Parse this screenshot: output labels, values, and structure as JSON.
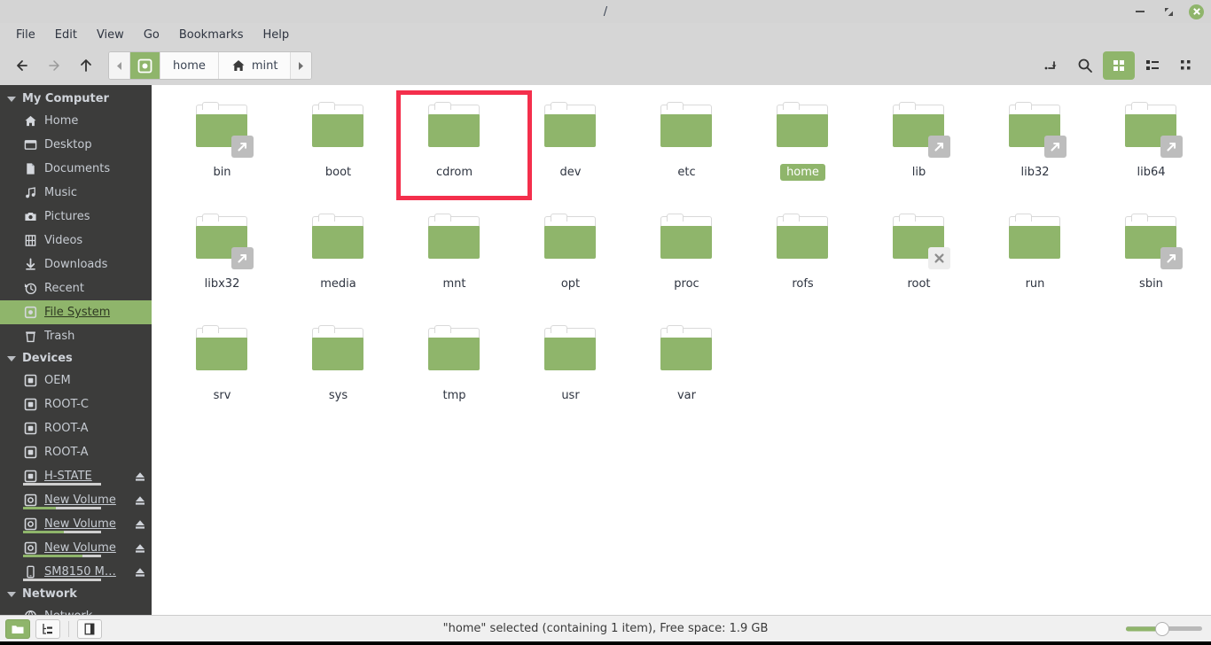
{
  "window": {
    "title": "/",
    "buttons": {
      "minimize": "minimize",
      "maximize": "maximize",
      "close": "close"
    }
  },
  "menubar": {
    "items": [
      "File",
      "Edit",
      "View",
      "Go",
      "Bookmarks",
      "Help"
    ]
  },
  "toolbar": {
    "back": "back-icon",
    "forward": "forward-icon",
    "up": "up-icon",
    "breadcrumb": {
      "scroll_left": "chevron-left-icon",
      "scroll_right": "chevron-right-icon",
      "items": [
        {
          "label": "",
          "icon": "file-system-icon",
          "active": true
        },
        {
          "label": "home",
          "icon": "",
          "active": false
        },
        {
          "label": "mint",
          "icon": "home-icon",
          "active": false
        }
      ]
    },
    "right_buttons": [
      {
        "name": "toggle-location-entry-button",
        "icon": "path-entry-icon",
        "active": false
      },
      {
        "name": "search-button",
        "icon": "search-icon",
        "active": false
      },
      {
        "name": "icon-view-button",
        "icon": "grid-view-icon",
        "active": true
      },
      {
        "name": "list-view-button",
        "icon": "list-view-icon",
        "active": false
      },
      {
        "name": "compact-view-button",
        "icon": "compact-view-icon",
        "active": false
      }
    ]
  },
  "sidebar": {
    "sections": [
      {
        "title": "My Computer",
        "items": [
          {
            "label": "Home",
            "icon": "home-icon",
            "selected": false
          },
          {
            "label": "Desktop",
            "icon": "desktop-icon",
            "selected": false
          },
          {
            "label": "Documents",
            "icon": "document-icon",
            "selected": false
          },
          {
            "label": "Music",
            "icon": "music-icon",
            "selected": false
          },
          {
            "label": "Pictures",
            "icon": "camera-icon",
            "selected": false
          },
          {
            "label": "Videos",
            "icon": "film-icon",
            "selected": false
          },
          {
            "label": "Downloads",
            "icon": "download-icon",
            "selected": false
          },
          {
            "label": "Recent",
            "icon": "clock-icon",
            "selected": false
          },
          {
            "label": "File System",
            "icon": "file-system-icon",
            "selected": true
          },
          {
            "label": "Trash",
            "icon": "trash-icon",
            "selected": false
          }
        ]
      },
      {
        "title": "Devices",
        "items": [
          {
            "label": "OEM",
            "icon": "drive-icon",
            "selected": false,
            "eject": false,
            "link": false,
            "usage": null
          },
          {
            "label": "ROOT-C",
            "icon": "drive-icon",
            "selected": false,
            "eject": false,
            "link": false,
            "usage": null
          },
          {
            "label": "ROOT-A",
            "icon": "drive-icon",
            "selected": false,
            "eject": false,
            "link": false,
            "usage": null
          },
          {
            "label": "ROOT-A",
            "icon": "drive-icon",
            "selected": false,
            "eject": false,
            "link": false,
            "usage": null
          },
          {
            "label": "H-STATE",
            "icon": "drive-icon",
            "selected": false,
            "eject": true,
            "link": true,
            "usage": 0
          },
          {
            "label": "New Volume",
            "icon": "disk-icon",
            "selected": false,
            "eject": true,
            "link": true,
            "usage": 42
          },
          {
            "label": "New Volume",
            "icon": "disk-icon",
            "selected": false,
            "eject": true,
            "link": true,
            "usage": 52
          },
          {
            "label": "New Volume",
            "icon": "disk-icon",
            "selected": false,
            "eject": true,
            "link": true,
            "usage": 76
          },
          {
            "label": "SM8150 M…",
            "icon": "phone-icon",
            "selected": false,
            "eject": true,
            "link": true,
            "usage": 0
          }
        ]
      },
      {
        "title": "Network",
        "items": [
          {
            "label": "Network",
            "icon": "network-icon",
            "selected": false
          }
        ]
      }
    ]
  },
  "files": {
    "items": [
      {
        "name": "bin",
        "badge": "symlink",
        "selected": false,
        "highlighted": false
      },
      {
        "name": "boot",
        "badge": "",
        "selected": false,
        "highlighted": false
      },
      {
        "name": "cdrom",
        "badge": "",
        "selected": false,
        "highlighted": true
      },
      {
        "name": "dev",
        "badge": "",
        "selected": false,
        "highlighted": false
      },
      {
        "name": "etc",
        "badge": "",
        "selected": false,
        "highlighted": false
      },
      {
        "name": "home",
        "badge": "",
        "selected": true,
        "highlighted": false
      },
      {
        "name": "lib",
        "badge": "symlink",
        "selected": false,
        "highlighted": false
      },
      {
        "name": "lib32",
        "badge": "symlink",
        "selected": false,
        "highlighted": false
      },
      {
        "name": "lib64",
        "badge": "symlink",
        "selected": false,
        "highlighted": false
      },
      {
        "name": "libx32",
        "badge": "symlink",
        "selected": false,
        "highlighted": false
      },
      {
        "name": "media",
        "badge": "",
        "selected": false,
        "highlighted": false
      },
      {
        "name": "mnt",
        "badge": "",
        "selected": false,
        "highlighted": false
      },
      {
        "name": "opt",
        "badge": "",
        "selected": false,
        "highlighted": false
      },
      {
        "name": "proc",
        "badge": "",
        "selected": false,
        "highlighted": false
      },
      {
        "name": "rofs",
        "badge": "",
        "selected": false,
        "highlighted": false
      },
      {
        "name": "root",
        "badge": "noaccess",
        "selected": false,
        "highlighted": false
      },
      {
        "name": "run",
        "badge": "",
        "selected": false,
        "highlighted": false
      },
      {
        "name": "sbin",
        "badge": "symlink",
        "selected": false,
        "highlighted": false
      },
      {
        "name": "srv",
        "badge": "",
        "selected": false,
        "highlighted": false
      },
      {
        "name": "sys",
        "badge": "",
        "selected": false,
        "highlighted": false
      },
      {
        "name": "tmp",
        "badge": "",
        "selected": false,
        "highlighted": false
      },
      {
        "name": "usr",
        "badge": "",
        "selected": false,
        "highlighted": false
      },
      {
        "name": "var",
        "badge": "",
        "selected": false,
        "highlighted": false
      }
    ]
  },
  "statusbar": {
    "text": "\"home\" selected (containing 1 item), Free space: 1.9 GB",
    "buttons": [
      {
        "name": "icon-view-toggle",
        "icon": "folder-icon",
        "active": true
      },
      {
        "name": "tree-view-toggle",
        "icon": "tree-icon",
        "active": false
      },
      {
        "name": "sidebar-toggle",
        "icon": "sidebar-icon",
        "active": false
      }
    ],
    "zoom_percent": 48
  },
  "colors": {
    "accent": "#8fb56b",
    "sidebar_bg": "#3c3c3b",
    "chrome_bg": "#d6d6d6",
    "highlight_ring": "#f42f4c",
    "folder": "#8fb56b"
  }
}
